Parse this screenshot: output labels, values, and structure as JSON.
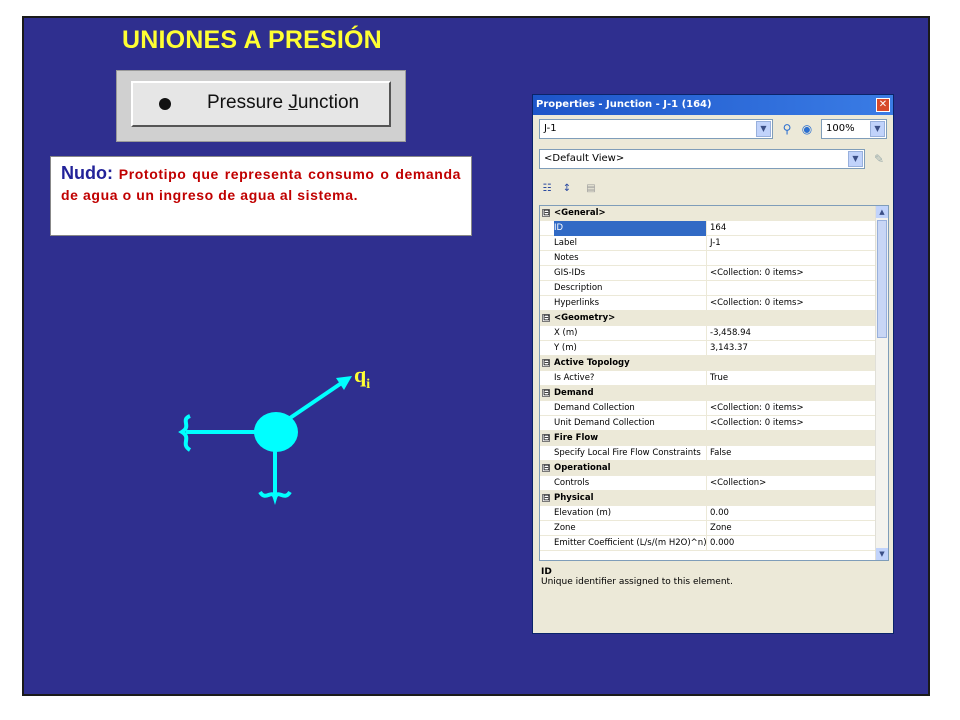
{
  "slide": {
    "title": "UNIONES A PRESIÓN",
    "button": {
      "pre": "Pressure ",
      "mnemonic": "J",
      "post": "unction"
    },
    "nudo": {
      "label": "Nudo:",
      "text": " Prototipo que representa consumo o demanda de agua o un ingreso de agua al sistema."
    },
    "diagram": {
      "label_base": "q",
      "label_sub": "i"
    }
  },
  "properties": {
    "title": "Properties - Junction - J-1 (164)",
    "element_combo": "J-1",
    "zoom": "100%",
    "view_combo": "<Default View>",
    "rows": [
      {
        "type": "cat",
        "name": "<General>",
        "exp": "⊟"
      },
      {
        "type": "prop",
        "name": "ID",
        "value": "164",
        "selected": true
      },
      {
        "type": "prop",
        "name": "Label",
        "value": "J-1"
      },
      {
        "type": "prop",
        "name": "Notes",
        "value": ""
      },
      {
        "type": "prop",
        "name": "GIS-IDs",
        "value": "<Collection: 0 items>"
      },
      {
        "type": "prop",
        "name": "Description",
        "value": ""
      },
      {
        "type": "prop",
        "name": "Hyperlinks",
        "value": "<Collection: 0 items>"
      },
      {
        "type": "cat",
        "name": "<Geometry>",
        "exp": "⊟"
      },
      {
        "type": "prop",
        "name": "X (m)",
        "value": "-3,458.94"
      },
      {
        "type": "prop",
        "name": "Y (m)",
        "value": "3,143.37"
      },
      {
        "type": "cat",
        "name": "Active Topology",
        "exp": "⊟"
      },
      {
        "type": "prop",
        "name": "Is Active?",
        "value": "True"
      },
      {
        "type": "cat",
        "name": "Demand",
        "exp": "⊟"
      },
      {
        "type": "prop",
        "name": "Demand Collection",
        "value": "<Collection: 0 items>"
      },
      {
        "type": "prop",
        "name": "Unit Demand Collection",
        "value": "<Collection: 0 items>"
      },
      {
        "type": "cat",
        "name": "Fire Flow",
        "exp": "⊟"
      },
      {
        "type": "prop",
        "name": "Specify Local Fire Flow Constraints",
        "value": "False"
      },
      {
        "type": "cat",
        "name": "Operational",
        "exp": "⊟"
      },
      {
        "type": "prop",
        "name": "Controls",
        "value": "<Collection>"
      },
      {
        "type": "cat",
        "name": "Physical",
        "exp": "⊟"
      },
      {
        "type": "prop",
        "name": "Elevation (m)",
        "value": "0.00"
      },
      {
        "type": "prop",
        "name": "Zone",
        "value": "Zone"
      },
      {
        "type": "prop",
        "name": "Emitter Coefficient (L/s/(m H2O)^n)",
        "value": "0.000"
      }
    ],
    "description": {
      "title": "ID",
      "text": "Unique identifier assigned to this element."
    }
  },
  "colors": {
    "slide_bg": "#2f2f8f",
    "title": "#ffff33",
    "node": "#00ffff",
    "label_q": "#ffff33",
    "nudo_text": "#c00000",
    "nudo_label": "#222299"
  }
}
